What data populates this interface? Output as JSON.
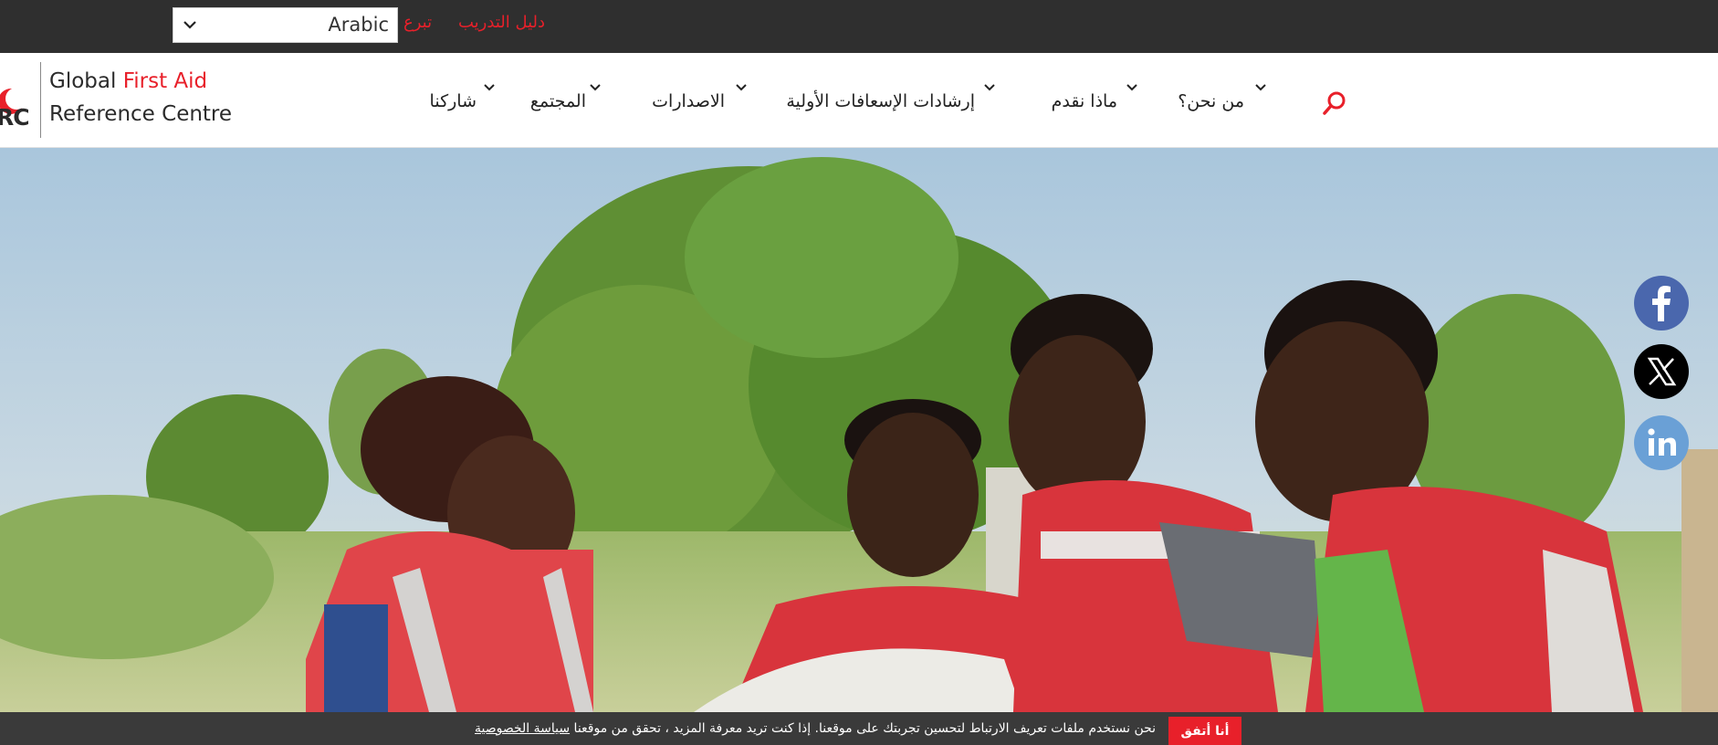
{
  "topbar": {
    "language_value": "Arabic",
    "donate_label": "تبرع",
    "training_label": "دليل التدريب"
  },
  "logo": {
    "mark_text": "RC",
    "line1_plain": "Global",
    "line1_accent": "First Aid",
    "line2": "Reference Centre"
  },
  "nav": {
    "items": [
      {
        "label": "من نحن؟"
      },
      {
        "label": "ماذا نقدم"
      },
      {
        "label": "إرشادات الإسعافات الأولية"
      },
      {
        "label": "الاصدارات"
      },
      {
        "label": "المجتمع"
      },
      {
        "label": "شاركنا"
      }
    ]
  },
  "social": {
    "facebook": "facebook-icon",
    "x": "x-icon",
    "linkedin": "linkedin-icon"
  },
  "cookie": {
    "message": "نحن نستخدم ملفات تعريف الارتباط لتحسين تجربتك على موقعنا. إذا كنت تريد معرفة المزيد ، تحقق من موقعنا",
    "policy_link": "سياسة الخصوصية",
    "accept_label": "أنا أتفق"
  },
  "colors": {
    "accent": "#e8202a",
    "topbar_bg": "#2f2f2f",
    "cookie_bg": "#3a3a3a"
  }
}
